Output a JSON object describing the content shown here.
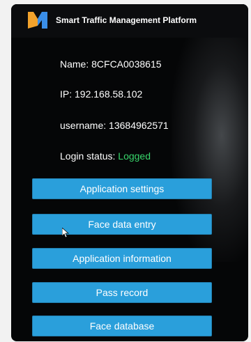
{
  "header": {
    "title": "Smart Traffic Management Platform",
    "logo_icon": "m-logo-icon",
    "logo_colors": [
      "#f2a22c",
      "#3a8ee8"
    ]
  },
  "device_info": {
    "name_label": "Name: ",
    "name_value": "8CFCA0038615",
    "ip_label": "IP: ",
    "ip_value": "192.168.58.102",
    "username_label": "username: ",
    "username_value": "13684962571",
    "login_status_label": "Login status: ",
    "login_status_value": "Logged",
    "login_status_color": "#38d66b"
  },
  "menu": {
    "button_color": "#2a9fdb",
    "items": [
      {
        "label": "Application settings"
      },
      {
        "label": "Face data entry"
      },
      {
        "label": "Application information"
      },
      {
        "label": "Pass record"
      },
      {
        "label": "Face database"
      }
    ]
  }
}
